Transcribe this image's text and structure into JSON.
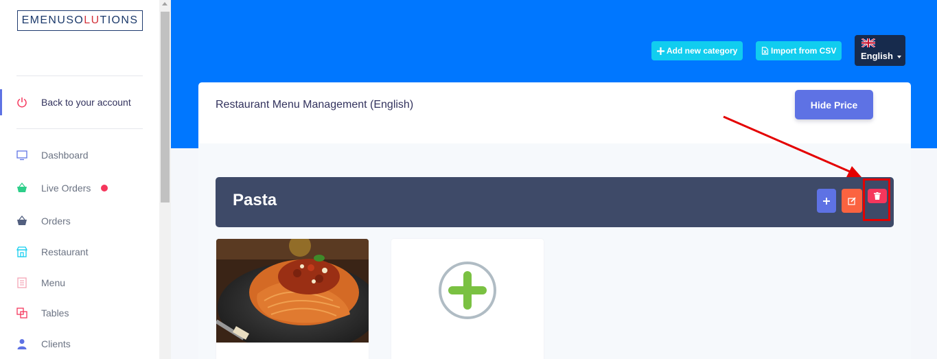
{
  "sidebar": {
    "logo": {
      "part1": "EMENUSO",
      "part2": "LU",
      "part3": "TIONS"
    },
    "back_link": "Back to your account",
    "items": [
      {
        "label": "Dashboard",
        "icon": "monitor-icon",
        "color": "#5e72e4"
      },
      {
        "label": "Live Orders",
        "icon": "basket-icon",
        "color": "#2dce89",
        "badge": true
      },
      {
        "label": "Orders",
        "icon": "basket-icon",
        "color": "#525f7f"
      },
      {
        "label": "Restaurant",
        "icon": "shop-icon",
        "color": "#11cdef"
      },
      {
        "label": "Menu",
        "icon": "book-icon",
        "color": "#f3a4b5"
      },
      {
        "label": "Tables",
        "icon": "tables-icon",
        "color": "#f5365c"
      },
      {
        "label": "Clients",
        "icon": "user-icon",
        "color": "#5e72e4"
      }
    ]
  },
  "header": {
    "add_category": "Add new category",
    "import_csv": "Import from CSV",
    "language": "English"
  },
  "main": {
    "title": "Restaurant Menu Management (English)",
    "hide_price": "Hide Price",
    "category": {
      "name": "Pasta"
    }
  },
  "colors": {
    "header": "#0077ff",
    "primary": "#5e72e4",
    "info": "#11cdef",
    "warning": "#fb6340",
    "danger": "#f5365c",
    "category_bar": "#3e4a68",
    "annotation": "#e40000"
  }
}
